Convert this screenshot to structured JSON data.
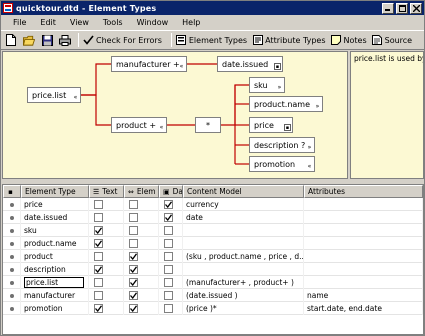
{
  "window": {
    "title": "quicktour.dtd - Element Types"
  },
  "menu": [
    "File",
    "Edit",
    "View",
    "Tools",
    "Window",
    "Help"
  ],
  "toolbar": {
    "check_errors": "Check For Errors",
    "element_types": "Element Types",
    "attribute_types": "Attribute Types",
    "notes": "Notes",
    "source": "Source"
  },
  "diagram": {
    "root": "price.list",
    "manufacturer": "manufacturer +",
    "date_issued": "date.issued",
    "product": "product +",
    "sequence": "*",
    "children": [
      "sku",
      "product.name",
      "price",
      "description ?",
      "promotion"
    ]
  },
  "info": {
    "text": "price.list is used by"
  },
  "table": {
    "headers": {
      "name": "Element Type",
      "text": "Text",
      "elem": "Elem",
      "data": "Data",
      "model": "Content Model",
      "attributes": "Attributes"
    },
    "rows": [
      {
        "name": "price",
        "text": false,
        "elem": false,
        "data": true,
        "model": "currency",
        "attributes": ""
      },
      {
        "name": "date.issued",
        "text": false,
        "elem": false,
        "data": true,
        "model": "date",
        "attributes": ""
      },
      {
        "name": "sku",
        "text": true,
        "elem": false,
        "data": false,
        "model": "",
        "attributes": ""
      },
      {
        "name": "product.name",
        "text": true,
        "elem": false,
        "data": false,
        "model": "",
        "attributes": ""
      },
      {
        "name": "product",
        "text": false,
        "elem": true,
        "data": false,
        "model": "(sku , product.name , price , d...",
        "attributes": ""
      },
      {
        "name": "description",
        "text": true,
        "elem": true,
        "data": false,
        "model": "",
        "attributes": ""
      },
      {
        "name": "price.list",
        "text": false,
        "elem": true,
        "data": false,
        "model": "(manufacturer+ , product+ )",
        "attributes": "",
        "editing": true
      },
      {
        "name": "manufacturer",
        "text": false,
        "elem": true,
        "data": false,
        "model": "(date.issued )",
        "attributes": "name"
      },
      {
        "name": "promotion",
        "text": true,
        "elem": true,
        "data": false,
        "model": "(price )*",
        "attributes": "start.date, end.date"
      }
    ]
  }
}
